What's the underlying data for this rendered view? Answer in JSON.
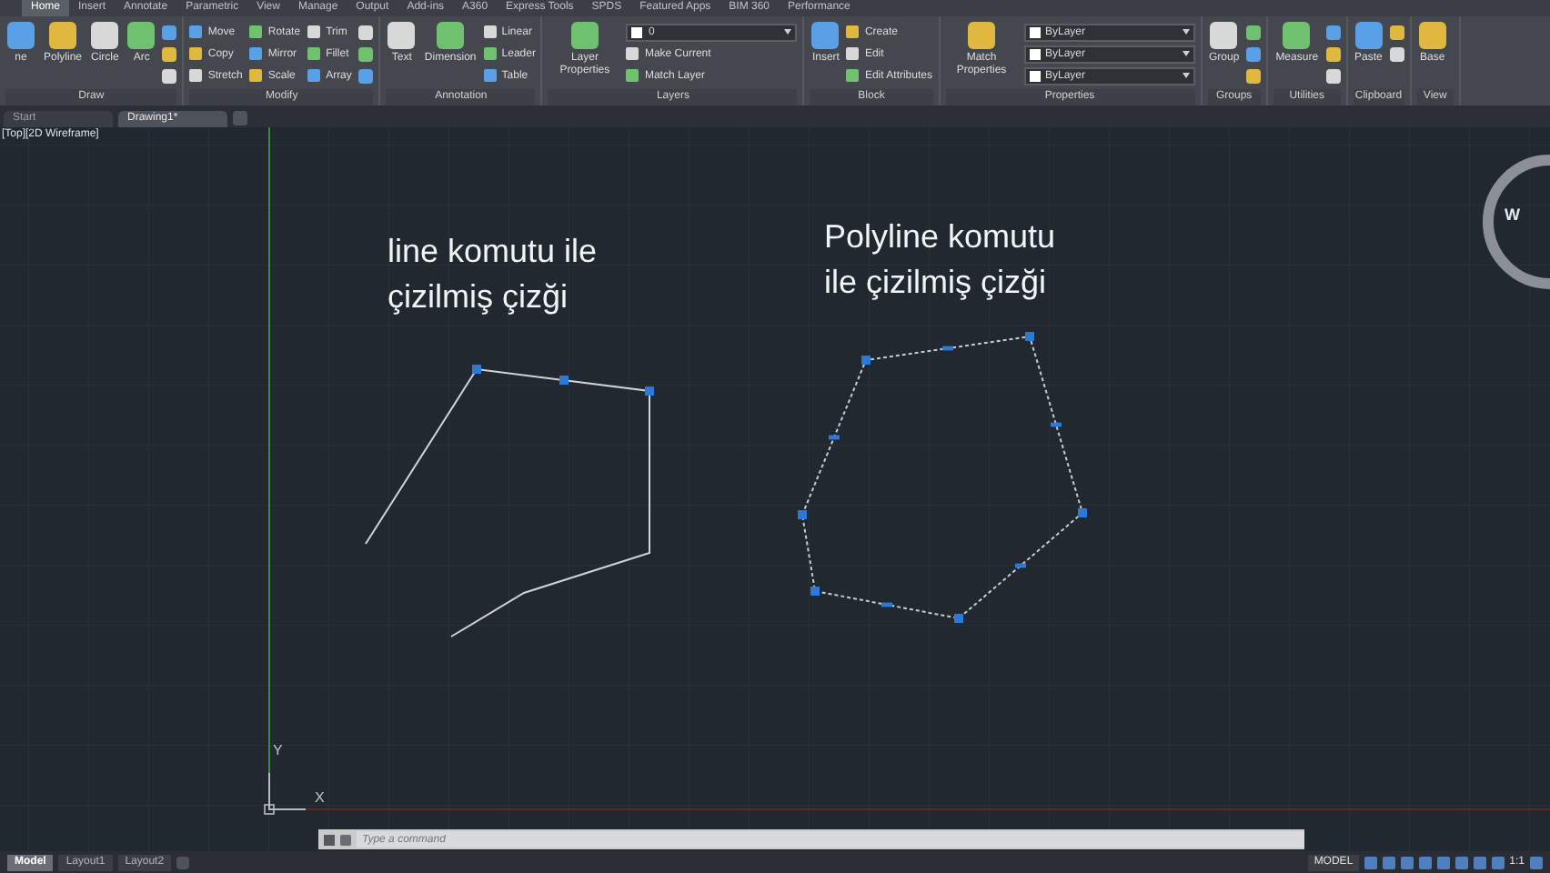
{
  "ribbon_tabs": [
    {
      "label": "Home",
      "selected": true
    },
    {
      "label": "Insert",
      "selected": false
    },
    {
      "label": "Annotate",
      "selected": false
    },
    {
      "label": "Parametric",
      "selected": false
    },
    {
      "label": "View",
      "selected": false
    },
    {
      "label": "Manage",
      "selected": false
    },
    {
      "label": "Output",
      "selected": false
    },
    {
      "label": "Add-ins",
      "selected": false
    },
    {
      "label": "A360",
      "selected": false
    },
    {
      "label": "Express Tools",
      "selected": false
    },
    {
      "label": "SPDS",
      "selected": false
    },
    {
      "label": "Featured Apps",
      "selected": false
    },
    {
      "label": "BIM 360",
      "selected": false
    },
    {
      "label": "Performance",
      "selected": false
    }
  ],
  "panels": [
    {
      "title": "Draw",
      "tools": [
        {
          "kind": "big",
          "label": "ne"
        },
        {
          "kind": "big",
          "label": "Polyline"
        },
        {
          "kind": "big",
          "label": "Circle"
        },
        {
          "kind": "big",
          "label": "Arc"
        },
        {
          "kind": "icon"
        },
        {
          "kind": "icon"
        },
        {
          "kind": "icon"
        }
      ]
    },
    {
      "title": "Modify",
      "tools": [
        {
          "kind": "small",
          "label": "Move"
        },
        {
          "kind": "small",
          "label": "Copy"
        },
        {
          "kind": "small",
          "label": "Stretch"
        },
        {
          "kind": "small",
          "label": "Rotate"
        },
        {
          "kind": "small",
          "label": "Mirror"
        },
        {
          "kind": "small",
          "label": "Scale"
        },
        {
          "kind": "small",
          "label": "Trim"
        },
        {
          "kind": "small",
          "label": "Fillet"
        },
        {
          "kind": "small",
          "label": "Array"
        },
        {
          "kind": "icon"
        },
        {
          "kind": "icon"
        },
        {
          "kind": "icon"
        }
      ]
    },
    {
      "title": "Annotation",
      "tools": [
        {
          "kind": "big",
          "label": "Text"
        },
        {
          "kind": "big",
          "label": "Dimension"
        },
        {
          "kind": "small",
          "label": "Linear"
        },
        {
          "kind": "small",
          "label": "Leader"
        },
        {
          "kind": "small",
          "label": "Table"
        }
      ]
    },
    {
      "title": "Layers",
      "tools": [
        {
          "kind": "big",
          "label": "Layer Properties"
        },
        {
          "kind": "dropdown",
          "label": "0"
        },
        {
          "kind": "small",
          "label": "Make Current"
        },
        {
          "kind": "small",
          "label": "Match Layer"
        }
      ]
    },
    {
      "title": "Block",
      "tools": [
        {
          "kind": "big",
          "label": "Insert"
        },
        {
          "kind": "small",
          "label": "Create"
        },
        {
          "kind": "small",
          "label": "Edit"
        },
        {
          "kind": "small",
          "label": "Edit Attributes"
        }
      ]
    },
    {
      "title": "Properties",
      "tools": [
        {
          "kind": "big",
          "label": "Match Properties"
        },
        {
          "kind": "dropdown",
          "label": "ByLayer"
        },
        {
          "kind": "dropdown",
          "label": "ByLayer"
        },
        {
          "kind": "dropdown",
          "label": "ByLayer"
        }
      ]
    },
    {
      "title": "Groups",
      "tools": [
        {
          "kind": "big",
          "label": "Group"
        },
        {
          "kind": "icon"
        },
        {
          "kind": "icon"
        },
        {
          "kind": "icon"
        }
      ]
    },
    {
      "title": "Utilities",
      "tools": [
        {
          "kind": "big",
          "label": "Measure"
        },
        {
          "kind": "icon"
        },
        {
          "kind": "icon"
        },
        {
          "kind": "icon"
        }
      ]
    },
    {
      "title": "Clipboard",
      "tools": [
        {
          "kind": "big",
          "label": "Paste"
        },
        {
          "kind": "icon"
        },
        {
          "kind": "icon"
        }
      ]
    },
    {
      "title": "View",
      "tools": [
        {
          "kind": "big",
          "label": "Base"
        }
      ]
    }
  ],
  "file_tabs": [
    {
      "label": "Start",
      "selected": false
    },
    {
      "label": "Drawing1*",
      "selected": true
    }
  ],
  "viewport_label": "[Top][2D Wireframe]",
  "annotations": [
    {
      "text": "line komutu ile çizilmiş çizği"
    },
    {
      "text": "Polyline komutu ile çizilmiş çizği"
    }
  ],
  "viewcube": {
    "label": "W"
  },
  "ucs": {
    "x": "X",
    "y": "Y"
  },
  "command_line": {
    "placeholder": "Type a command"
  },
  "layout_tabs": [
    {
      "label": "Model",
      "selected": true
    },
    {
      "label": "Layout1",
      "selected": false
    },
    {
      "label": "Layout2",
      "selected": false
    }
  ],
  "status_bar": {
    "mode": "MODEL",
    "scale": "1:1"
  }
}
